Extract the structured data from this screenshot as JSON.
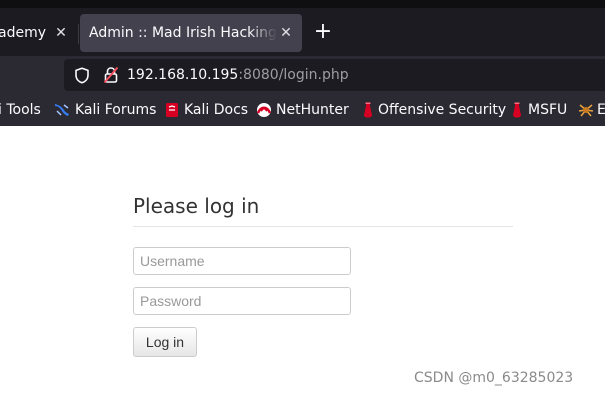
{
  "tabs": [
    {
      "title": "ademy",
      "active": false
    },
    {
      "title": "Admin :: Mad Irish Hacking Academy",
      "active": true
    }
  ],
  "new_tab_symbol": "+",
  "close_symbol": "✕",
  "address_bar": {
    "host": "192.168.10.195",
    "rest": ":8080/login.php"
  },
  "bookmarks": [
    {
      "label": "i Tools",
      "icon": "kali-tools-icon"
    },
    {
      "label": "Kali Forums",
      "icon": "kali-forums-icon"
    },
    {
      "label": "Kali Docs",
      "icon": "kali-docs-icon"
    },
    {
      "label": "NetHunter",
      "icon": "nethunter-icon"
    },
    {
      "label": "Offensive Security",
      "icon": "offsec-icon"
    },
    {
      "label": "MSFU",
      "icon": "msfu-icon"
    },
    {
      "label": "E",
      "icon": "exploit-db-icon"
    }
  ],
  "login": {
    "heading": "Please log in",
    "username_placeholder": "Username",
    "password_placeholder": "Password",
    "button_label": "Log in"
  },
  "watermark": "CSDN @m0_63285023",
  "colors": {
    "toolbar_dark": "#1c1b22",
    "toolbar": "#2b2a33",
    "active_tab": "#42414d",
    "bookmark_red": "#d70022",
    "brand_blue": "#367bf0"
  }
}
